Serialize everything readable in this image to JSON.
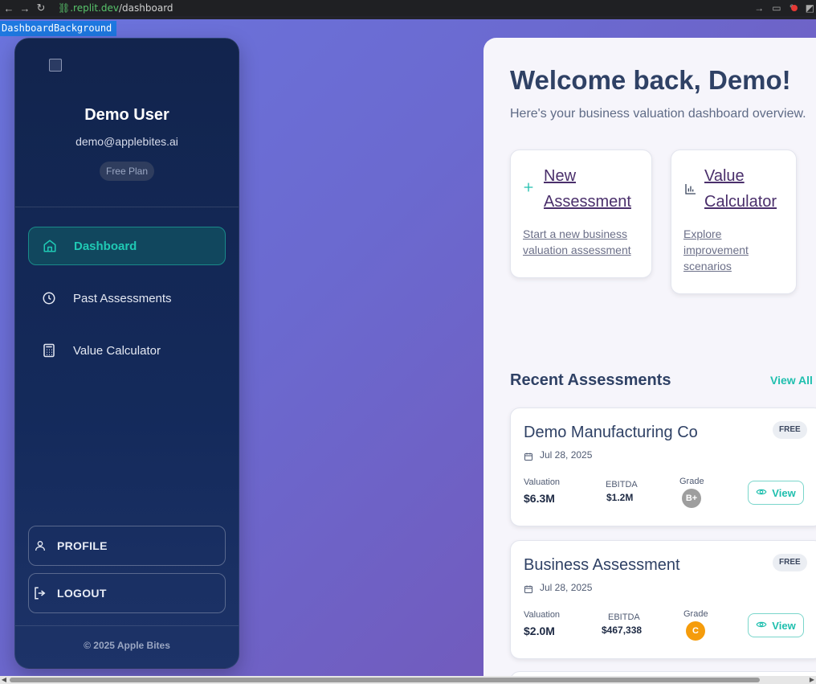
{
  "browser": {
    "url_host": ".replit.dev",
    "url_path": "/dashboard"
  },
  "debug_tag": "DashboardBackground",
  "sidebar": {
    "user_name": "Demo User",
    "user_email": "demo@applebites.ai",
    "plan": "Free Plan",
    "nav": [
      {
        "label": "Dashboard",
        "icon": "home-icon",
        "active": true
      },
      {
        "label": "Past Assessments",
        "icon": "clock-icon",
        "active": false
      },
      {
        "label": "Value Calculator",
        "icon": "calculator-icon",
        "active": false
      }
    ],
    "profile_label": "PROFILE",
    "logout_label": "LOGOUT",
    "copyright": "© 2025 Apple Bites"
  },
  "main": {
    "welcome": "Welcome back, Demo!",
    "subtitle": "Here's your business valuation dashboard overview.",
    "actions": [
      {
        "title_line1": "New",
        "title_line2": "Assessment",
        "desc_line1": "Start a new business",
        "desc_line2": "valuation assessment",
        "icon": "plus-icon"
      },
      {
        "title_line1": "Value",
        "title_line2": "Calculator",
        "desc_line1": "Explore",
        "desc_line2": "improvement",
        "desc_line3": "scenarios",
        "icon": "bar-chart-icon"
      }
    ],
    "recent_title": "Recent Assessments",
    "view_all": "View All",
    "assessments": [
      {
        "name": "Demo Manufacturing Co",
        "tier": "FREE",
        "date": "Jul 28, 2025",
        "valuation_label": "Valuation",
        "valuation": "$6.3M",
        "ebitda_label": "EBITDA",
        "ebitda": "$1.2M",
        "grade_label": "Grade",
        "grade": "B+",
        "grade_color": "#9e9e9e",
        "view_label": "View"
      },
      {
        "name": "Business Assessment",
        "tier": "FREE",
        "date": "Jul 28, 2025",
        "valuation_label": "Valuation",
        "valuation": "$2.0M",
        "ebitda_label": "EBITDA",
        "ebitda": "$467,338",
        "grade_label": "Grade",
        "grade": "C",
        "grade_color": "#f59c0b",
        "view_label": "View"
      }
    ]
  },
  "colors": {
    "accent": "#1fbfae",
    "sidebar_bg": "#12244d",
    "main_bg": "#f6f5fb"
  }
}
